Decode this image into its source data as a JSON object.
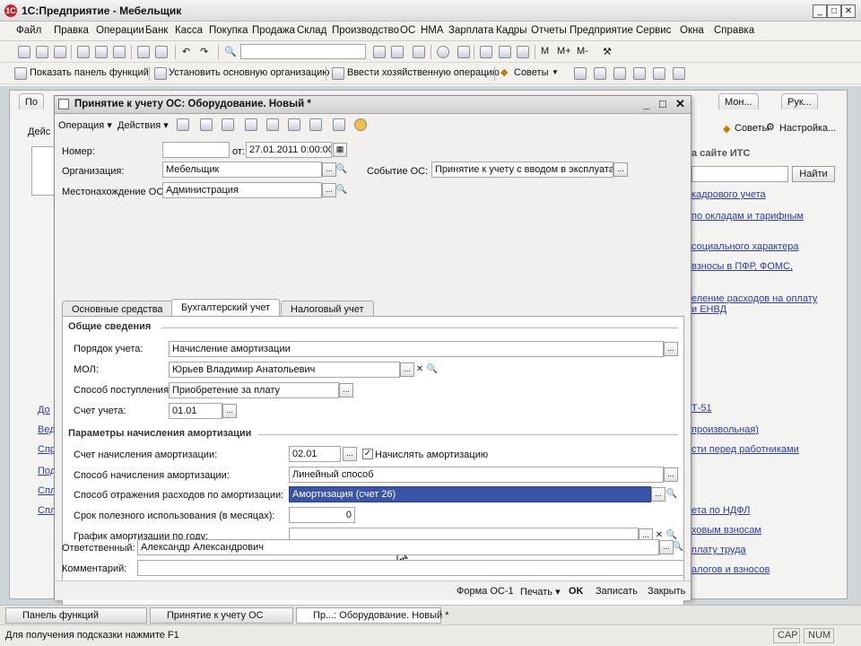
{
  "app": {
    "title": "1С:Предприятие - Мебельщик"
  },
  "menu": [
    "Файл",
    "Правка",
    "Операции",
    "Банк",
    "Касса",
    "Покупка",
    "Продажа",
    "Склад",
    "Производство",
    "ОС",
    "НМА",
    "Зарплата",
    "Кадры",
    "Отчеты",
    "Предприятие",
    "Сервис",
    "Окна",
    "Справка"
  ],
  "toolbar2": {
    "show_panel": "Показать панель функций",
    "set_org": "Установить основную организацию",
    "enter_op": "Ввести хозяйственную операцию",
    "tips": "Советы"
  },
  "bg": {
    "tab_pan": "По",
    "tab_mon": "Мон...",
    "tab_ruk": "Рук...",
    "deys": "Дейс",
    "tips": "Советы",
    "settings": "Настройка...",
    "its": "а сайте ИТС",
    "find": "Найти",
    "links1": [
      "кадрового учета",
      "по окладам и тарифным",
      "социального характера",
      "взносы в ПФР, ФОМС,",
      "еление расходов на оплату",
      "и ЕНВД"
    ],
    "links2": [
      "Т-51",
      "произвольная)",
      "сти перед работниками",
      "ета по НДФЛ",
      "ховым взносам",
      "плату труда",
      "алогов и взносов"
    ],
    "left_links": [
      "До",
      "Вед",
      "Спр",
      "Под",
      "Спл",
      "Спл"
    ]
  },
  "dialog": {
    "title": "Принятие к учету ОС: Оборудование. Новый *",
    "toolbar": {
      "operation": "Операция",
      "actions": "Действия"
    },
    "number_label": "Номер:",
    "number_value": "",
    "from_label": "от:",
    "date_value": "27.01.2011  0:00:00",
    "org_label": "Организация:",
    "org_value": "Мебельщик",
    "event_label": "Событие ОС:",
    "event_value": "Принятие к учету с вводом в эксплуатаци",
    "location_label": "Местонахождение ОС:",
    "location_value": "Администрация",
    "tabs": [
      "Основные средства",
      "Бухгалтерский учет",
      "Налоговый учет"
    ],
    "general_section": "Общие сведения",
    "acc_order_label": "Порядок учета:",
    "acc_order_value": "Начисление амортизации",
    "mol_label": "МОЛ:",
    "mol_value": "Юрьев Владимир Анатольевич",
    "receipt_label": "Способ поступления:",
    "receipt_value": "Приобретение за плату",
    "account_label": "Счет учета:",
    "account_value": "01.01",
    "depr_section": "Параметры начисления амортизации",
    "depr_account_label": "Счет начисления амортизации:",
    "depr_account_value": "02.01",
    "accrue_label": "Начислять амортизацию",
    "accrue_checked": true,
    "depr_method_label": "Способ начисления амортизации:",
    "depr_method_value": "Линейный способ",
    "depr_expense_label": "Способ отражения расходов по амортизации:",
    "depr_expense_value": "Амортизация (счет 26)",
    "useful_life_label": "Срок полезного использования (в месяцах):",
    "useful_life_value": "0",
    "schedule_label": "График амортизации по году:",
    "schedule_value": "",
    "responsible_label": "Ответственный:",
    "responsible_value": "Александр Александрович",
    "comment_label": "Комментарий:",
    "comment_value": "",
    "bottom": {
      "form": "Форма ОС-1",
      "print": "Печать",
      "ok": "OK",
      "write": "Записать",
      "close": "Закрыть"
    }
  },
  "taskbar": [
    "Панель функций",
    "Принятие к учету ОС",
    "Пр...: Оборудование. Новый *"
  ],
  "status": {
    "hint": "Для получения подсказки нажмите F1",
    "cap": "CAP",
    "num": "NUM"
  }
}
